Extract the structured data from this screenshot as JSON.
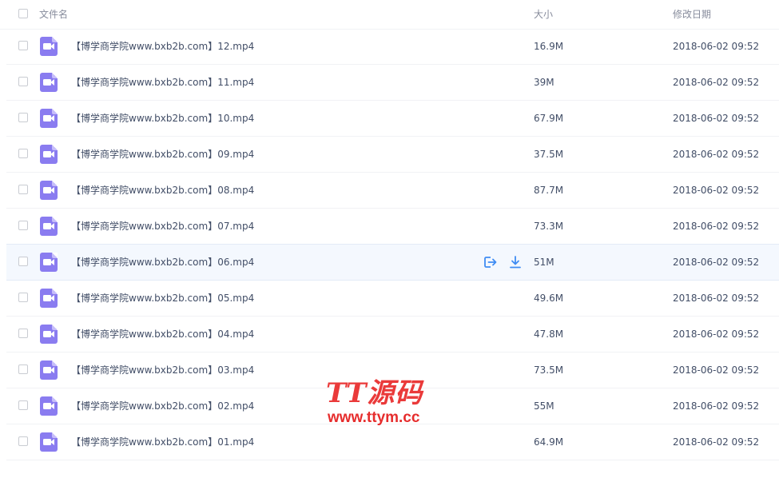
{
  "header": {
    "name_label": "文件名",
    "size_label": "大小",
    "date_label": "修改日期"
  },
  "files": [
    {
      "name": "【博学商学院www.bxb2b.com】12.mp4",
      "size": "16.9M",
      "date": "2018-06-02 09:52"
    },
    {
      "name": "【博学商学院www.bxb2b.com】11.mp4",
      "size": "39M",
      "date": "2018-06-02 09:52"
    },
    {
      "name": "【博学商学院www.bxb2b.com】10.mp4",
      "size": "67.9M",
      "date": "2018-06-02 09:52"
    },
    {
      "name": "【博学商学院www.bxb2b.com】09.mp4",
      "size": "37.5M",
      "date": "2018-06-02 09:52"
    },
    {
      "name": "【博学商学院www.bxb2b.com】08.mp4",
      "size": "87.7M",
      "date": "2018-06-02 09:52"
    },
    {
      "name": "【博学商学院www.bxb2b.com】07.mp4",
      "size": "73.3M",
      "date": "2018-06-02 09:52"
    },
    {
      "name": "【博学商学院www.bxb2b.com】06.mp4",
      "size": "51M",
      "date": "2018-06-02 09:52"
    },
    {
      "name": "【博学商学院www.bxb2b.com】05.mp4",
      "size": "49.6M",
      "date": "2018-06-02 09:52"
    },
    {
      "name": "【博学商学院www.bxb2b.com】04.mp4",
      "size": "47.8M",
      "date": "2018-06-02 09:52"
    },
    {
      "name": "【博学商学院www.bxb2b.com】03.mp4",
      "size": "73.5M",
      "date": "2018-06-02 09:52"
    },
    {
      "name": "【博学商学院www.bxb2b.com】02.mp4",
      "size": "55M",
      "date": "2018-06-02 09:52"
    },
    {
      "name": "【博学商学院www.bxb2b.com】01.mp4",
      "size": "64.9M",
      "date": "2018-06-02 09:52"
    }
  ],
  "hover_row_index": 6,
  "icons": {
    "file": "video-file-icon",
    "share": "share-icon",
    "download": "download-icon"
  },
  "colors": {
    "accent": "#3f8cf3",
    "file_icon": "#8a7cf0",
    "hover_bg": "#f4f8fe",
    "watermark": "#ea3a3a"
  },
  "watermark": {
    "logo": "TT源码",
    "url": "www.ttym.cc"
  }
}
